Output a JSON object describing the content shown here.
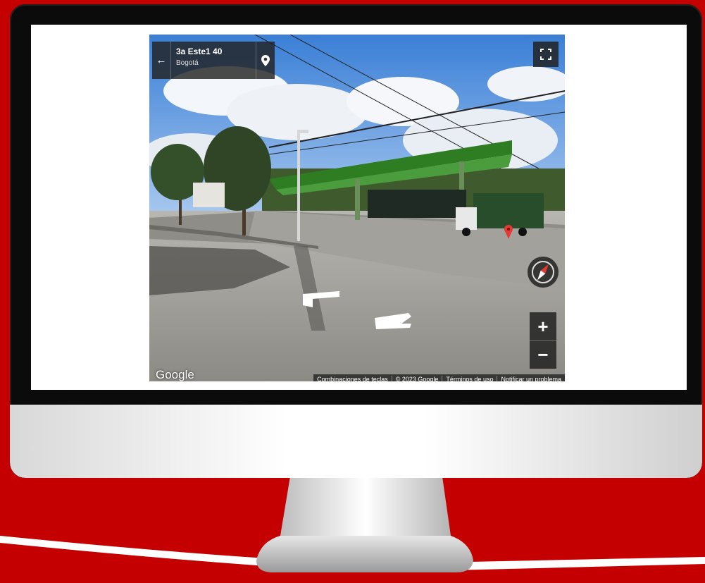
{
  "streetview": {
    "address": "3a Este1 40",
    "city": "Bogotá",
    "back_icon": "←",
    "zoom_in": "+",
    "zoom_out": "−",
    "logo": "Google",
    "footer": [
      "Combinaciones de teclas",
      "© 2023 Google",
      "Términos de uso",
      "Notificar un problema"
    ]
  },
  "colors": {
    "background": "#c40000",
    "bezel": "#0b0b0b",
    "canopy": "#2e7d22",
    "pin": "#e53935"
  }
}
